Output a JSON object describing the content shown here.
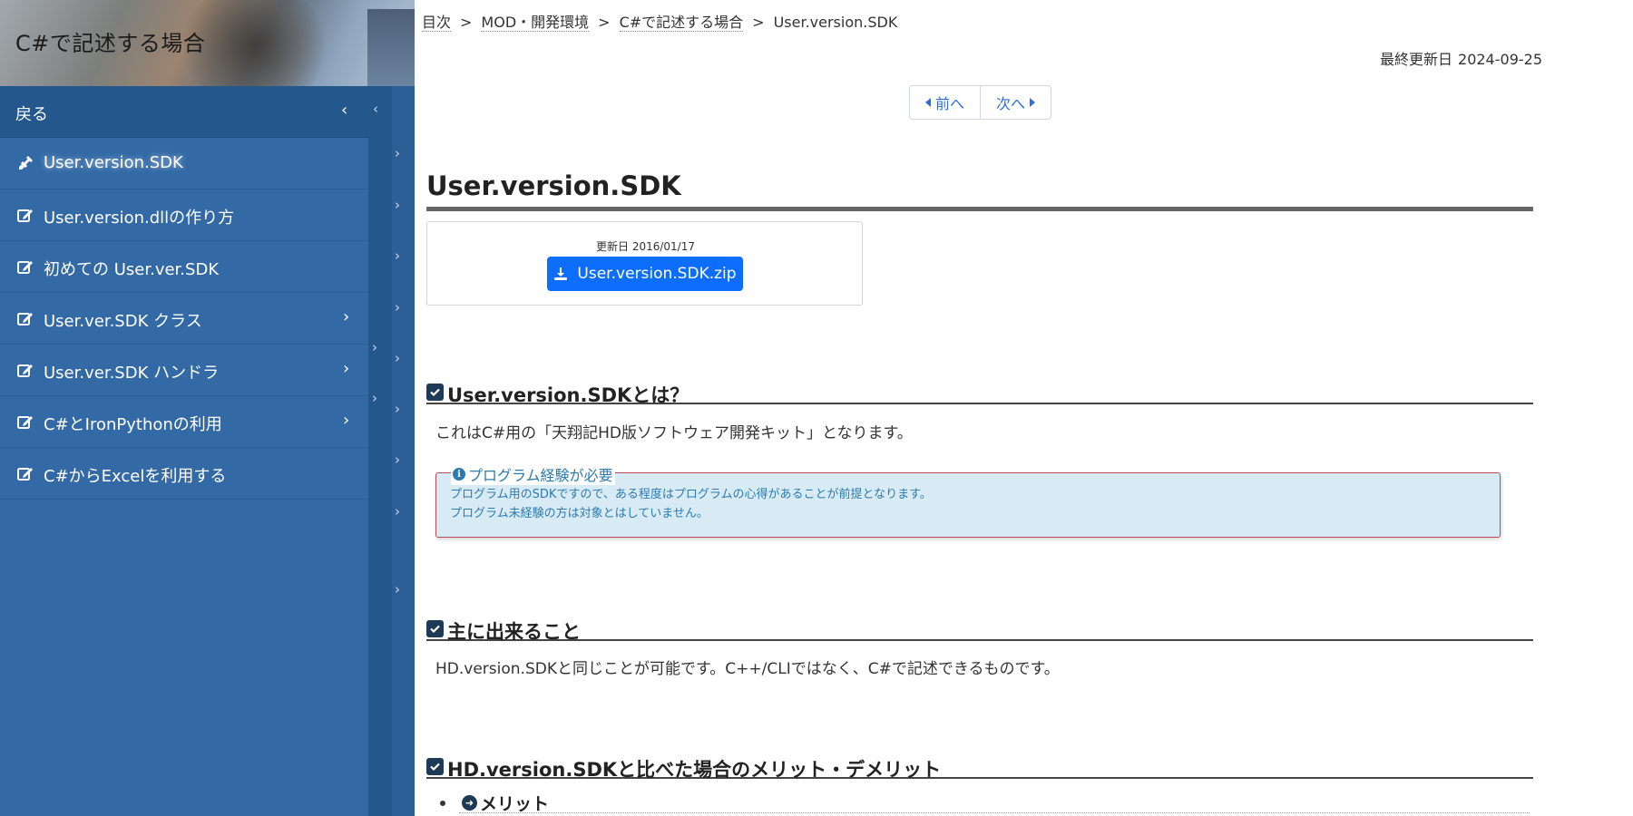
{
  "sidebar": {
    "title": "C#で記述する場合",
    "back_label": "戻る",
    "items": [
      {
        "label": "User.version.SDK",
        "icon": "plug-icon",
        "active": true
      },
      {
        "label": "User.version.dllの作り方",
        "icon": "edit-icon"
      },
      {
        "label": "初めての User.ver.SDK",
        "icon": "edit-icon"
      },
      {
        "label": "User.ver.SDK クラス",
        "icon": "edit-icon"
      },
      {
        "label": "User.ver.SDK ハンドラ",
        "icon": "edit-icon"
      },
      {
        "label": "C#とIronPythonの利用",
        "icon": "edit-icon"
      },
      {
        "label": "C#からExcelを利用する",
        "icon": "edit-icon"
      }
    ]
  },
  "breadcrumb": {
    "items": [
      "目次",
      "MOD・開発環境",
      "C#で記述する場合"
    ],
    "current": "User.version.SDK",
    "separator": ">"
  },
  "updated": {
    "label": "最終更新日",
    "date": "2024-09-25"
  },
  "pager": {
    "prev": "前へ",
    "next": "次へ"
  },
  "page_title": "User.version.SDK",
  "download": {
    "date_text": "更新日 2016/01/17",
    "file_label": "User.version.SDK.zip"
  },
  "sections": {
    "about": {
      "heading": "User.version.SDKとは？",
      "text": "これはC#用の「天翔記HD版ソフトウェア開発キット」となります。",
      "notice": {
        "title": "プログラム経験が必要",
        "lines": [
          "プログラム用のSDKですので、ある程度はプログラムの心得があることが前提となります。",
          "プログラム未経験の方は対象とはしていません。"
        ]
      }
    },
    "features": {
      "heading": "主に出来ること",
      "text": "HD.version.SDKと同じことが可能です。C++/CLIではなく、C#で記述できるものです。"
    },
    "compare": {
      "heading": "HD.version.SDKと比べた場合のメリット・デメリット",
      "merit_label": "メリット"
    }
  },
  "colors": {
    "sidebar_bg": "#336aa6",
    "accent_blue": "#0d6efd",
    "notice_bg": "#d8ebf5",
    "checkbox": "#1f3a56"
  }
}
